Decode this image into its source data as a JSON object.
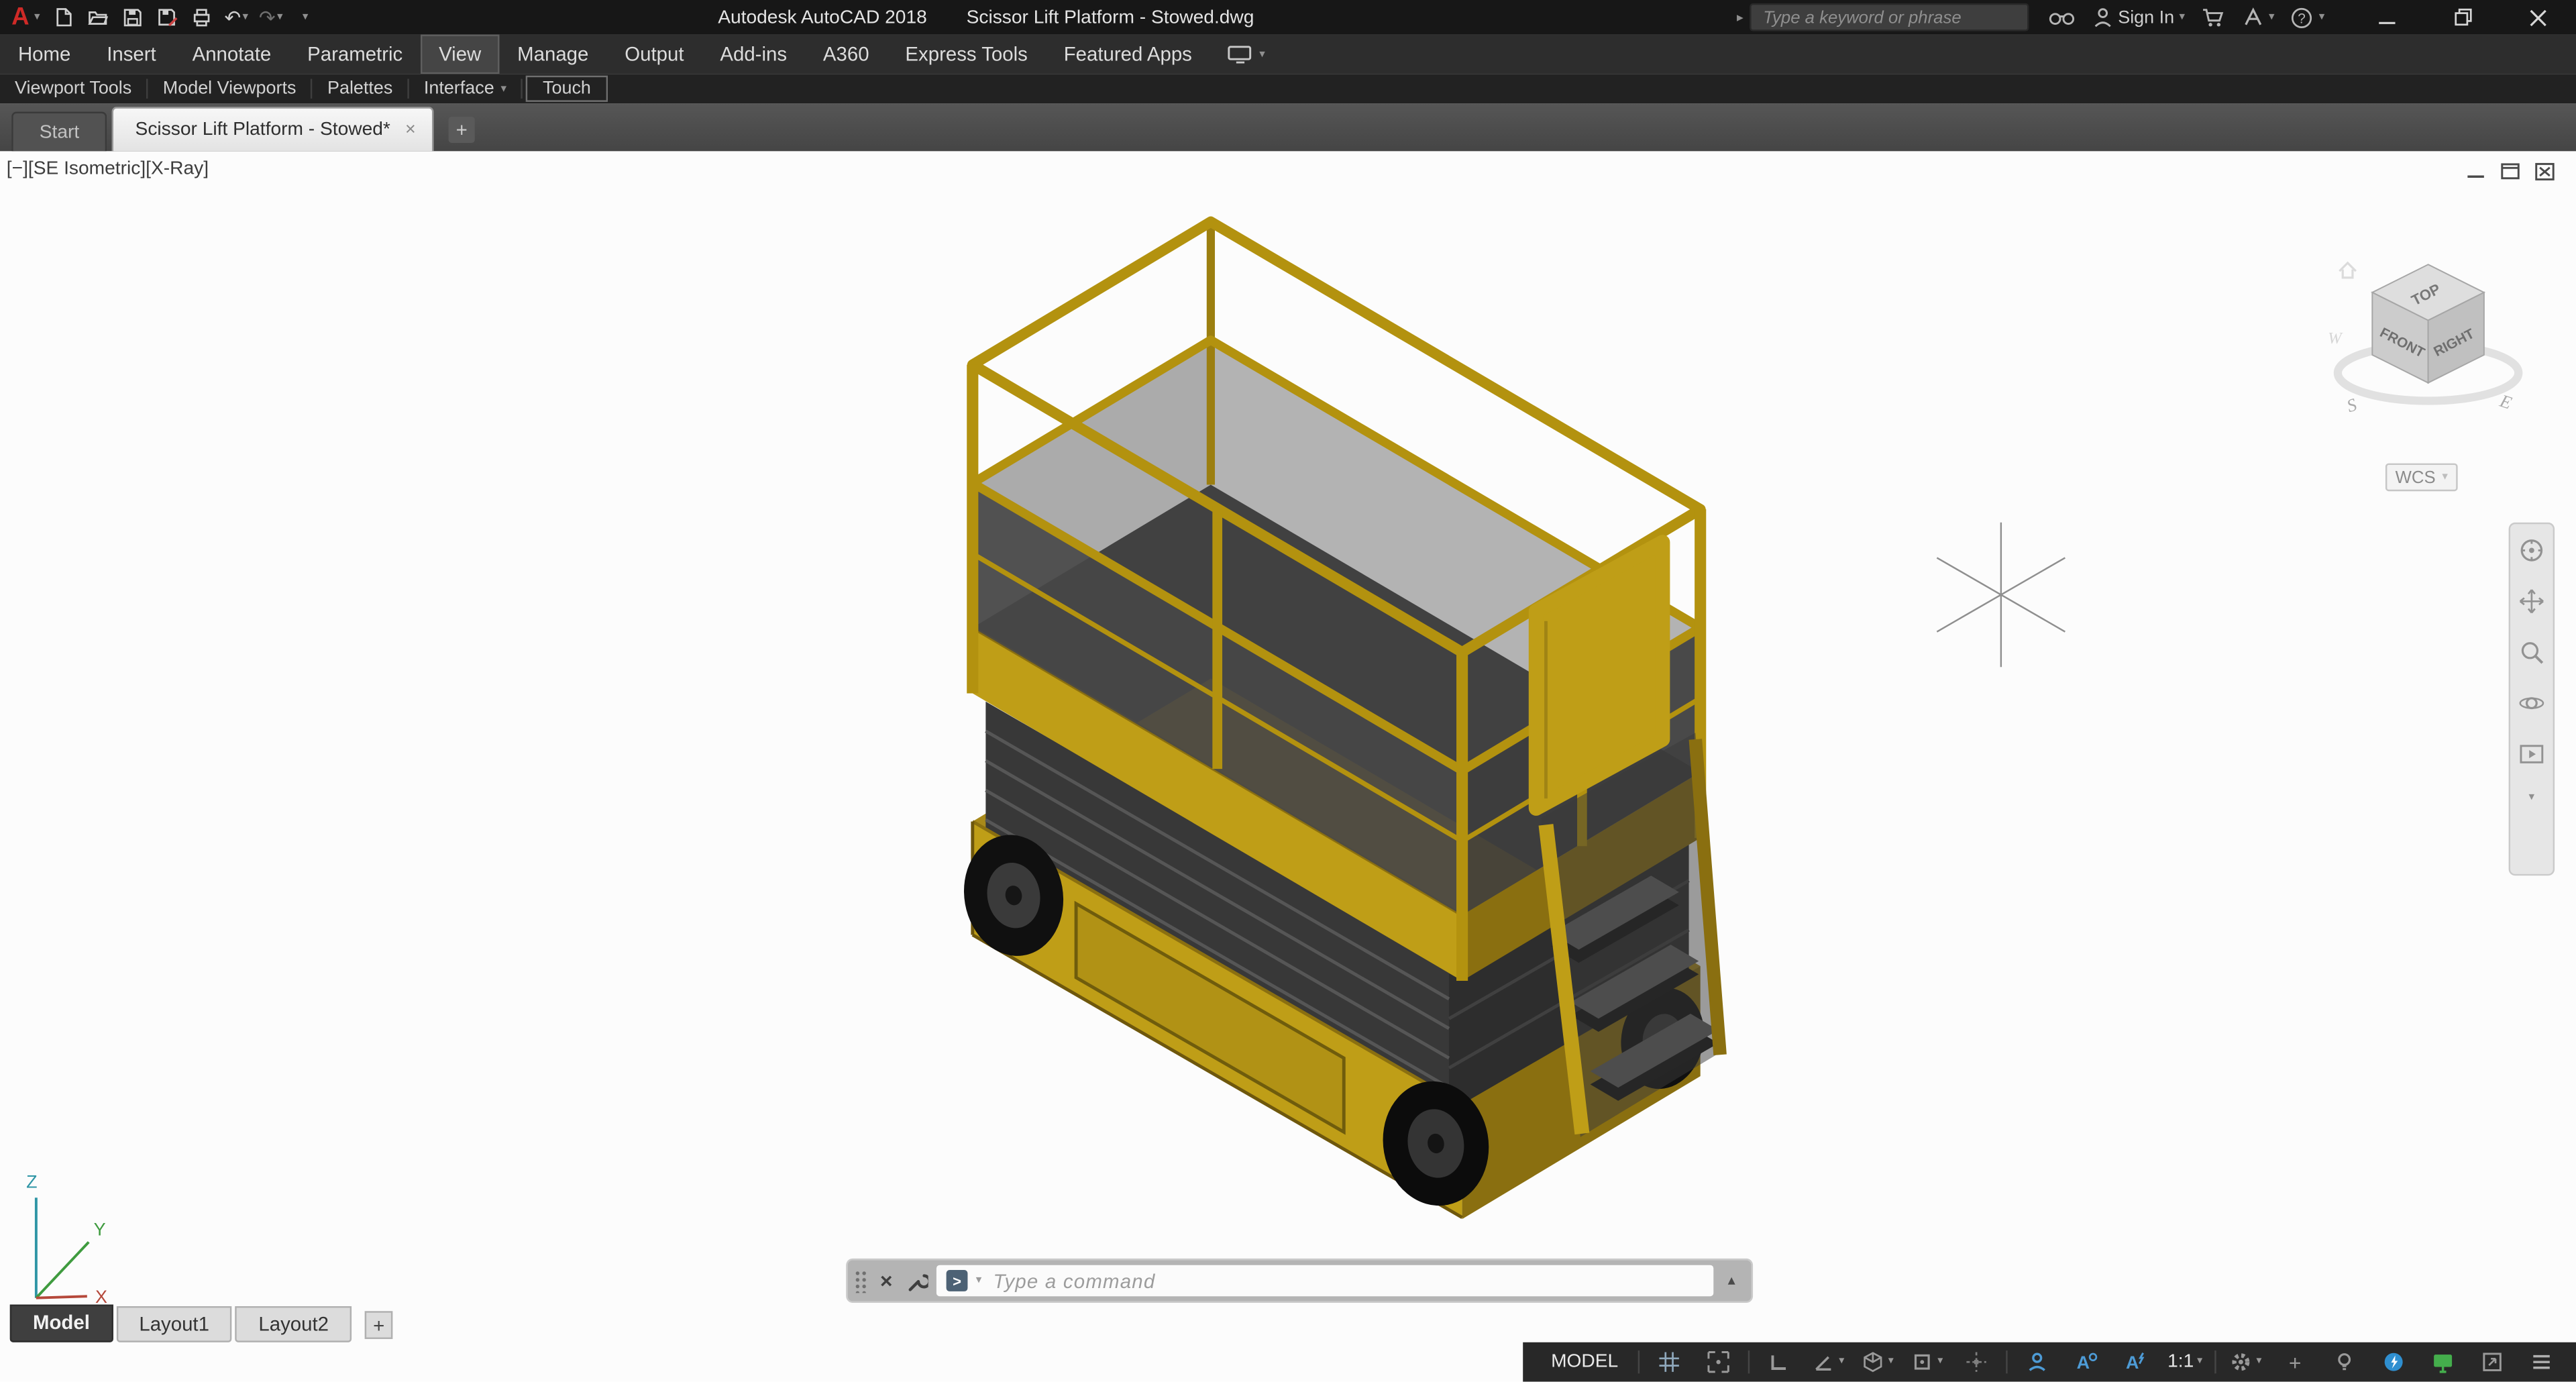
{
  "colors": {
    "lift-yellow": "#bf9e17",
    "lift-yellow-dark": "#8a6f10",
    "rail-yellow": "#b3920f",
    "deck-gray": "#414141",
    "stack-gray": "#383838",
    "accent-blue": "#4d9bd6",
    "status-green": "#44ae4c",
    "titlebar-bg": "#171717",
    "menubar-bg": "#2d2d2d",
    "statusbar-bg": "#282828"
  },
  "title_bar": {
    "logo": "A",
    "product": "Autodesk AutoCAD 2018",
    "document": "Scissor Lift Platform - Stowed.dwg",
    "search_placeholder": "Type a keyword or phrase",
    "sign_in": "Sign In"
  },
  "icons": {
    "caret_down": "▾",
    "caret_up": "▴",
    "expand_right": "▸",
    "undo": "↶",
    "redo": "↷",
    "close": "×",
    "minimize": "─",
    "help": "?",
    "plus": "+",
    "prompt": ">"
  },
  "menu": {
    "items": [
      "Home",
      "Insert",
      "Annotate",
      "Parametric",
      "View",
      "Manage",
      "Output",
      "Add-ins",
      "A360",
      "Express Tools",
      "Featured Apps"
    ]
  },
  "panel_row": {
    "items": [
      "Viewport Tools",
      "Model Viewports",
      "Palettes",
      "Interface",
      "Touch"
    ]
  },
  "file_tabs": {
    "start": "Start",
    "active": "Scissor Lift Platform - Stowed*"
  },
  "viewport": {
    "label": "[−][SE Isometric][X-Ray]"
  },
  "viewcube": {
    "top": "TOP",
    "front": "FRONT",
    "right": "RIGHT",
    "w": "W",
    "s": "S",
    "e": "E",
    "wcs": "WCS"
  },
  "ucs": {
    "x": "X",
    "y": "Y",
    "z": "Z"
  },
  "command_line": {
    "placeholder": "Type a command"
  },
  "layout_tabs": {
    "items": [
      "Model",
      "Layout1",
      "Layout2"
    ]
  },
  "status_bar": {
    "model": "MODEL",
    "scale": "1:1"
  }
}
